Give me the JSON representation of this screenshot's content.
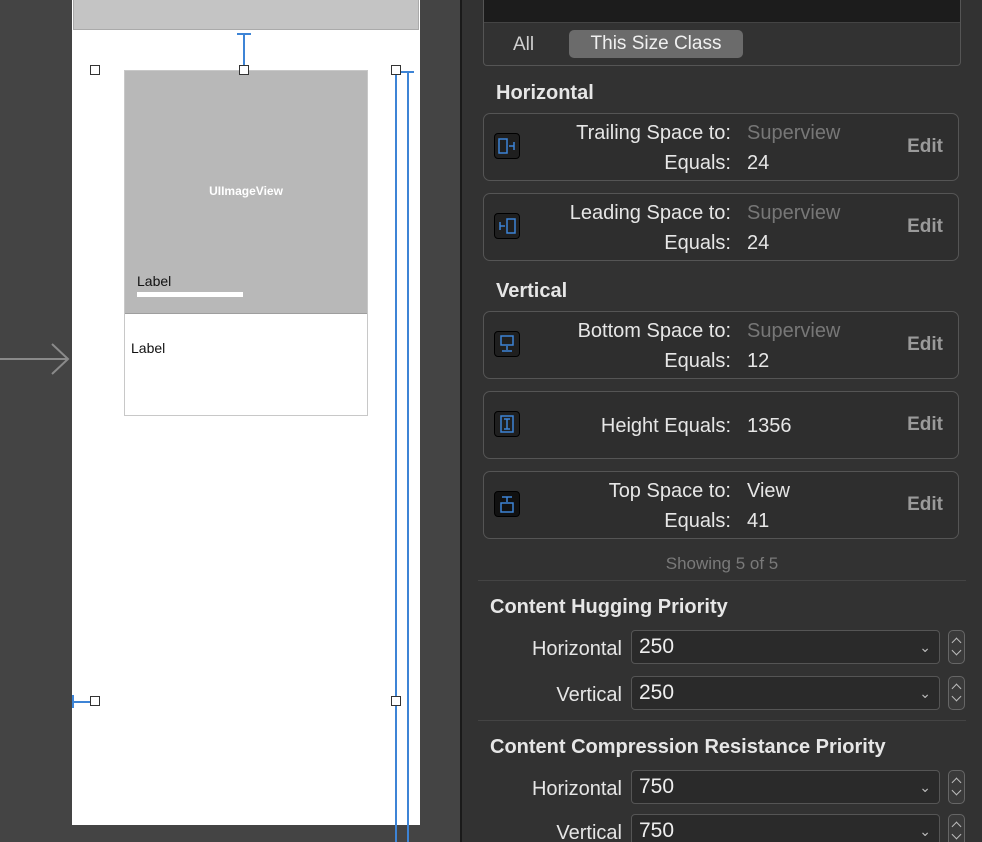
{
  "canvas": {
    "image_view_label": "UIImageView",
    "overlay_label": "Label",
    "body_label": "Label"
  },
  "size_class": {
    "all_label": "All",
    "this_label": "This Size Class"
  },
  "horizontal": {
    "heading": "Horizontal",
    "constraints": [
      {
        "title": "Trailing Space to:",
        "target": "Superview",
        "equals_label": "Equals:",
        "value": "24",
        "edit": "Edit",
        "icon": "trailing-space-icon"
      },
      {
        "title": "Leading Space to:",
        "target": "Superview",
        "equals_label": "Equals:",
        "value": "24",
        "edit": "Edit",
        "icon": "leading-space-icon"
      }
    ]
  },
  "vertical": {
    "heading": "Vertical",
    "constraints": [
      {
        "title": "Bottom Space to:",
        "target": "Superview",
        "equals_label": "Equals:",
        "value": "12",
        "edit": "Edit",
        "icon": "bottom-space-icon"
      },
      {
        "title": "Height Equals:",
        "value": "1356",
        "edit": "Edit",
        "icon": "height-icon"
      },
      {
        "title": "Top Space to:",
        "target": "View",
        "equals_label": "Equals:",
        "value": "41",
        "edit": "Edit",
        "icon": "top-space-icon"
      }
    ]
  },
  "showing": "Showing 5 of 5",
  "hugging": {
    "heading": "Content Hugging Priority",
    "horizontal_label": "Horizontal",
    "horizontal_value": "250",
    "vertical_label": "Vertical",
    "vertical_value": "250"
  },
  "compression": {
    "heading": "Content Compression Resistance Priority",
    "horizontal_label": "Horizontal",
    "horizontal_value": "750",
    "vertical_label": "Vertical",
    "vertical_value": "750"
  },
  "colors": {
    "accent": "#3d84d6",
    "selected_segment": "#6b6b6b"
  }
}
